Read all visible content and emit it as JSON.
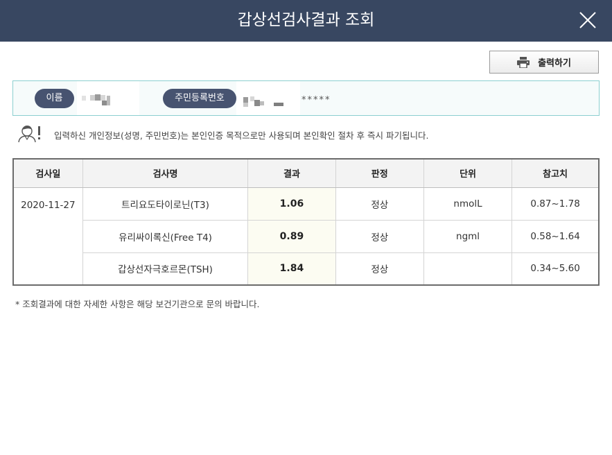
{
  "dialog": {
    "title": "갑상선검사결과 조회"
  },
  "toolbar": {
    "print_label": "출력하기",
    "print_icon": "printer-icon"
  },
  "person": {
    "name_label": "이름",
    "rrn_label": "주민등록번호",
    "rrn_masked_tail": "*****"
  },
  "notice": {
    "icon": "person-alert-icon",
    "text": "입력하신 개인정보(성명, 주민번호)는 본인인증 목적으로만 사용되며 본인확인 절차 후 즉시 파기됩니다."
  },
  "table": {
    "headers": [
      "검사일",
      "검사명",
      "결과",
      "판정",
      "단위",
      "참고치"
    ],
    "date": "2020-11-27",
    "rows": [
      {
        "name": "트리요도타이로닌(T3)",
        "result": "1.06",
        "judgement": "정상",
        "unit": "nmolL",
        "reference": "0.87~1.78"
      },
      {
        "name": "유리싸이록신(Free T4)",
        "result": "0.89",
        "judgement": "정상",
        "unit": "ngml",
        "reference": "0.58~1.64"
      },
      {
        "name": "갑상선자극호르몬(TSH)",
        "result": "1.84",
        "judgement": "정상",
        "unit": "",
        "reference": "0.34~5.60"
      }
    ]
  },
  "footnote": "* 조회결과에 대한 자세한 사항은 해당 보건기관으로 문의 바랍니다.",
  "colors": {
    "titlebar_bg": "#384761",
    "pill_bg": "#475370",
    "info_border": "#8ccfd0",
    "result_cell_bg": "#fcfcf2"
  }
}
